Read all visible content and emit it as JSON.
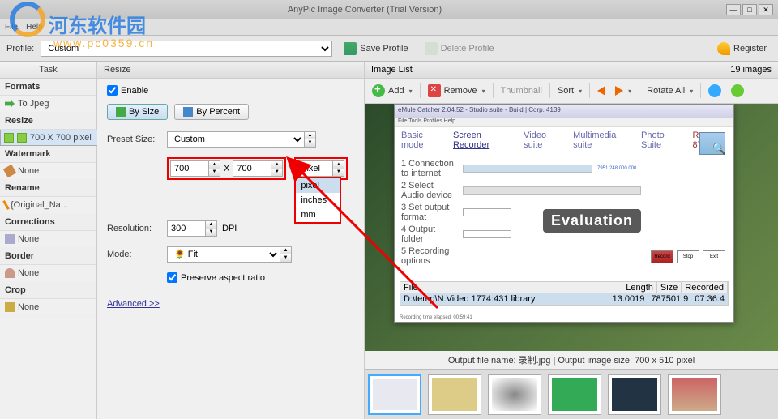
{
  "app": {
    "title": "AnyPic Image Converter (Trial Version)",
    "menu": {
      "file": "File",
      "help": "Help"
    }
  },
  "watermark": {
    "text1": "河东软件园",
    "text2": "www.pc0359.cn"
  },
  "profilebar": {
    "label": "Profile:",
    "value": "Custom",
    "save": "Save Profile",
    "delete": "Delete Profile",
    "register": "Register"
  },
  "sidebar": {
    "head": "Task",
    "formats": {
      "title": "Formats",
      "item": "To Jpeg"
    },
    "resize": {
      "title": "Resize",
      "item": "700 X 700 pixel"
    },
    "watermark": {
      "title": "Watermark",
      "item": "None"
    },
    "rename": {
      "title": "Rename",
      "item": "{Original_Na..."
    },
    "corrections": {
      "title": "Corrections",
      "item": "None"
    },
    "border": {
      "title": "Border",
      "item": "None"
    },
    "crop": {
      "title": "Crop",
      "item": "None"
    }
  },
  "resize": {
    "head": "Resize",
    "enable": "Enable",
    "by_size": "By Size",
    "by_percent": "By Percent",
    "preset_label": "Preset Size:",
    "preset_value": "Custom",
    "width": "700",
    "x": "X",
    "height": "700",
    "unit": "pixel",
    "unit_opts": [
      "pixel",
      "inches",
      "mm"
    ],
    "res_label": "Resolution:",
    "res_value": "300",
    "res_unit": "DPI",
    "mode_label": "Mode:",
    "mode_value": "Fit",
    "preserve": "Preserve aspect ratio",
    "advanced": "Advanced >>"
  },
  "imagelist": {
    "head": "Image List",
    "count": "19 images",
    "add": "Add",
    "remove": "Remove",
    "thumbnail": "Thumbnail",
    "sort": "Sort",
    "rotate": "Rotate All"
  },
  "preview": {
    "win_title": "eMule Catcher 2.04.52 - Studio suite - Build | Corp. 4139",
    "menu": "File  Tools  Profiles  Help",
    "tabs": [
      "Basic mode",
      "Screen Recorder",
      "Video suite",
      "Multimedia suite",
      "Photo Suite"
    ],
    "rev": "Rev 8757",
    "row1": "1 Connection to internet",
    "row2": "2 Select Audio device",
    "row3": "3 Set output format",
    "row4": "4 Output folder",
    "row5": "5 Recording options",
    "badge": "Evaluation",
    "btns": [
      "Record",
      "Stop",
      "Exit"
    ],
    "list_h": [
      "File",
      "Length",
      "Size",
      "Recorded"
    ],
    "list_r": [
      "D:\\temp\\N.Video   1774:431 library",
      "13.0019",
      "787501.9",
      "07:36:4"
    ],
    "status": "Recording time elapsed: 00:59:41"
  },
  "output": {
    "text": "Output file name: 录制.jpg | Output image size: 700 x 510 pixel"
  }
}
